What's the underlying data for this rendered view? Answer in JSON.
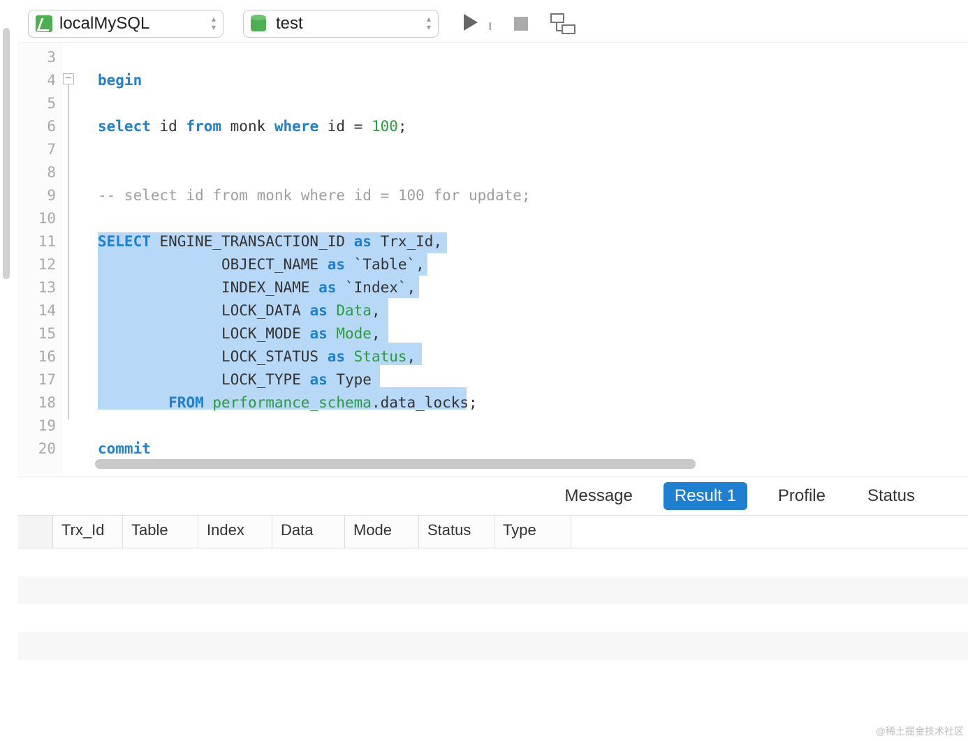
{
  "toolbar": {
    "connection": "localMySQL",
    "database": "test"
  },
  "editor": {
    "first_line_number": 3,
    "lines": [
      "",
      "begin",
      "",
      "select id from monk where id = 100;",
      "",
      "",
      "-- select id from monk where id = 100 for update;",
      "",
      "SELECT ENGINE_TRANSACTION_ID as Trx_Id,",
      "              OBJECT_NAME as `Table`,",
      "              INDEX_NAME as `Index`,",
      "              LOCK_DATA as Data,",
      "              LOCK_MODE as Mode,",
      "              LOCK_STATUS as Status,",
      "              LOCK_TYPE as Type",
      "        FROM performance_schema.data_locks;",
      "",
      "commit"
    ],
    "raw_line4": "begin",
    "raw_line6_pre": "select",
    "raw_line6_mid": " id ",
    "raw_line6_from": "from",
    "raw_line6_mid2": " monk ",
    "raw_line6_where": "where",
    "raw_line6_mid3": " id = ",
    "raw_line6_num": "100",
    "raw_line6_end": ";",
    "raw_line9": "-- select id from monk where id = 100 for update;",
    "raw_line11_sel": "SELECT",
    "raw_line11_rest": " ENGINE_TRANSACTION_ID ",
    "raw_line11_as": "as",
    "raw_line11_alias": " Trx_Id,",
    "raw_line12_pre": "              OBJECT_NAME ",
    "raw_line12_as": "as",
    "raw_line12_alias": " `Table`,",
    "raw_line13_pre": "              INDEX_NAME ",
    "raw_line13_as": "as",
    "raw_line13_alias": " `Index`,",
    "raw_line14_pre": "              LOCK_DATA ",
    "raw_line14_as": "as",
    "raw_line14_alias_kw": " Data",
    "raw_line14_comma": ",",
    "raw_line15_pre": "              LOCK_MODE ",
    "raw_line15_as": "as",
    "raw_line15_alias_kw": " Mode",
    "raw_line15_comma": ",",
    "raw_line16_pre": "              LOCK_STATUS ",
    "raw_line16_as": "as",
    "raw_line16_alias_kw": " Status",
    "raw_line16_comma": ",",
    "raw_line17_pre": "              LOCK_TYPE ",
    "raw_line17_as": "as",
    "raw_line17_alias": " Type",
    "raw_line18_pre": "        ",
    "raw_line18_from": "FROM",
    "raw_line18_schema": " performance_schema",
    "raw_line18_dot": ".data_locks;",
    "raw_line20": "commit"
  },
  "result_tabs": {
    "message": "Message",
    "result1": "Result 1",
    "profile": "Profile",
    "status": "Status"
  },
  "grid_headers": [
    "Trx_Id",
    "Table",
    "Index",
    "Data",
    "Mode",
    "Status",
    "Type"
  ],
  "watermark": "@稀土掘金技术社区"
}
